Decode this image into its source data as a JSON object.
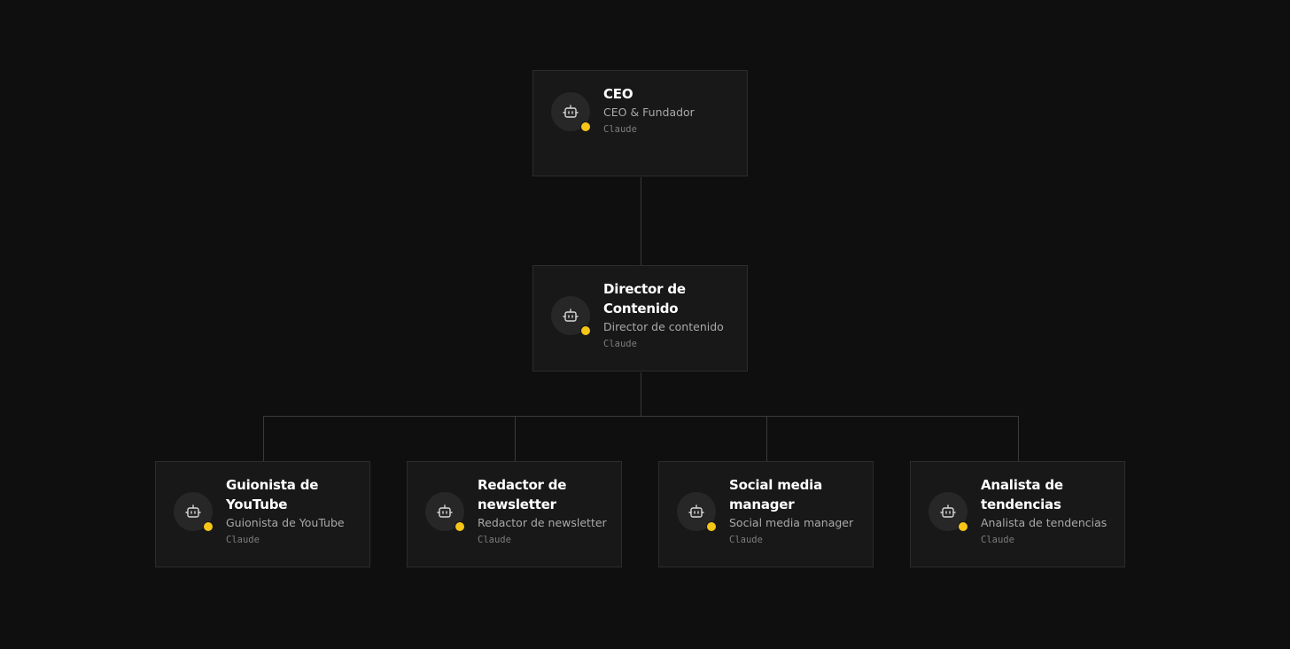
{
  "colors": {
    "background": "#0f0f0f",
    "card": "#181818",
    "card_border": "#2c2c2c",
    "connector": "#3a3a3a",
    "status": "#f5c518"
  },
  "org": {
    "ceo": {
      "name": "CEO",
      "role": "CEO & Fundador",
      "model": "Claude",
      "icon": "robot-icon"
    },
    "director": {
      "name": "Director de Contenido",
      "role": "Director de contenido",
      "model": "Claude",
      "icon": "robot-icon"
    },
    "reports": [
      {
        "name": "Guionista de YouTube",
        "role": "Guionista de YouTube",
        "model": "Claude",
        "icon": "robot-icon"
      },
      {
        "name": "Redactor de newsletter",
        "role": "Redactor de newsletter",
        "model": "Claude",
        "icon": "robot-icon"
      },
      {
        "name": "Social media manager",
        "role": "Social media manager",
        "model": "Claude",
        "icon": "robot-icon"
      },
      {
        "name": "Analista de tendencias",
        "role": "Analista de tendencias",
        "model": "Claude",
        "icon": "robot-icon"
      }
    ]
  }
}
